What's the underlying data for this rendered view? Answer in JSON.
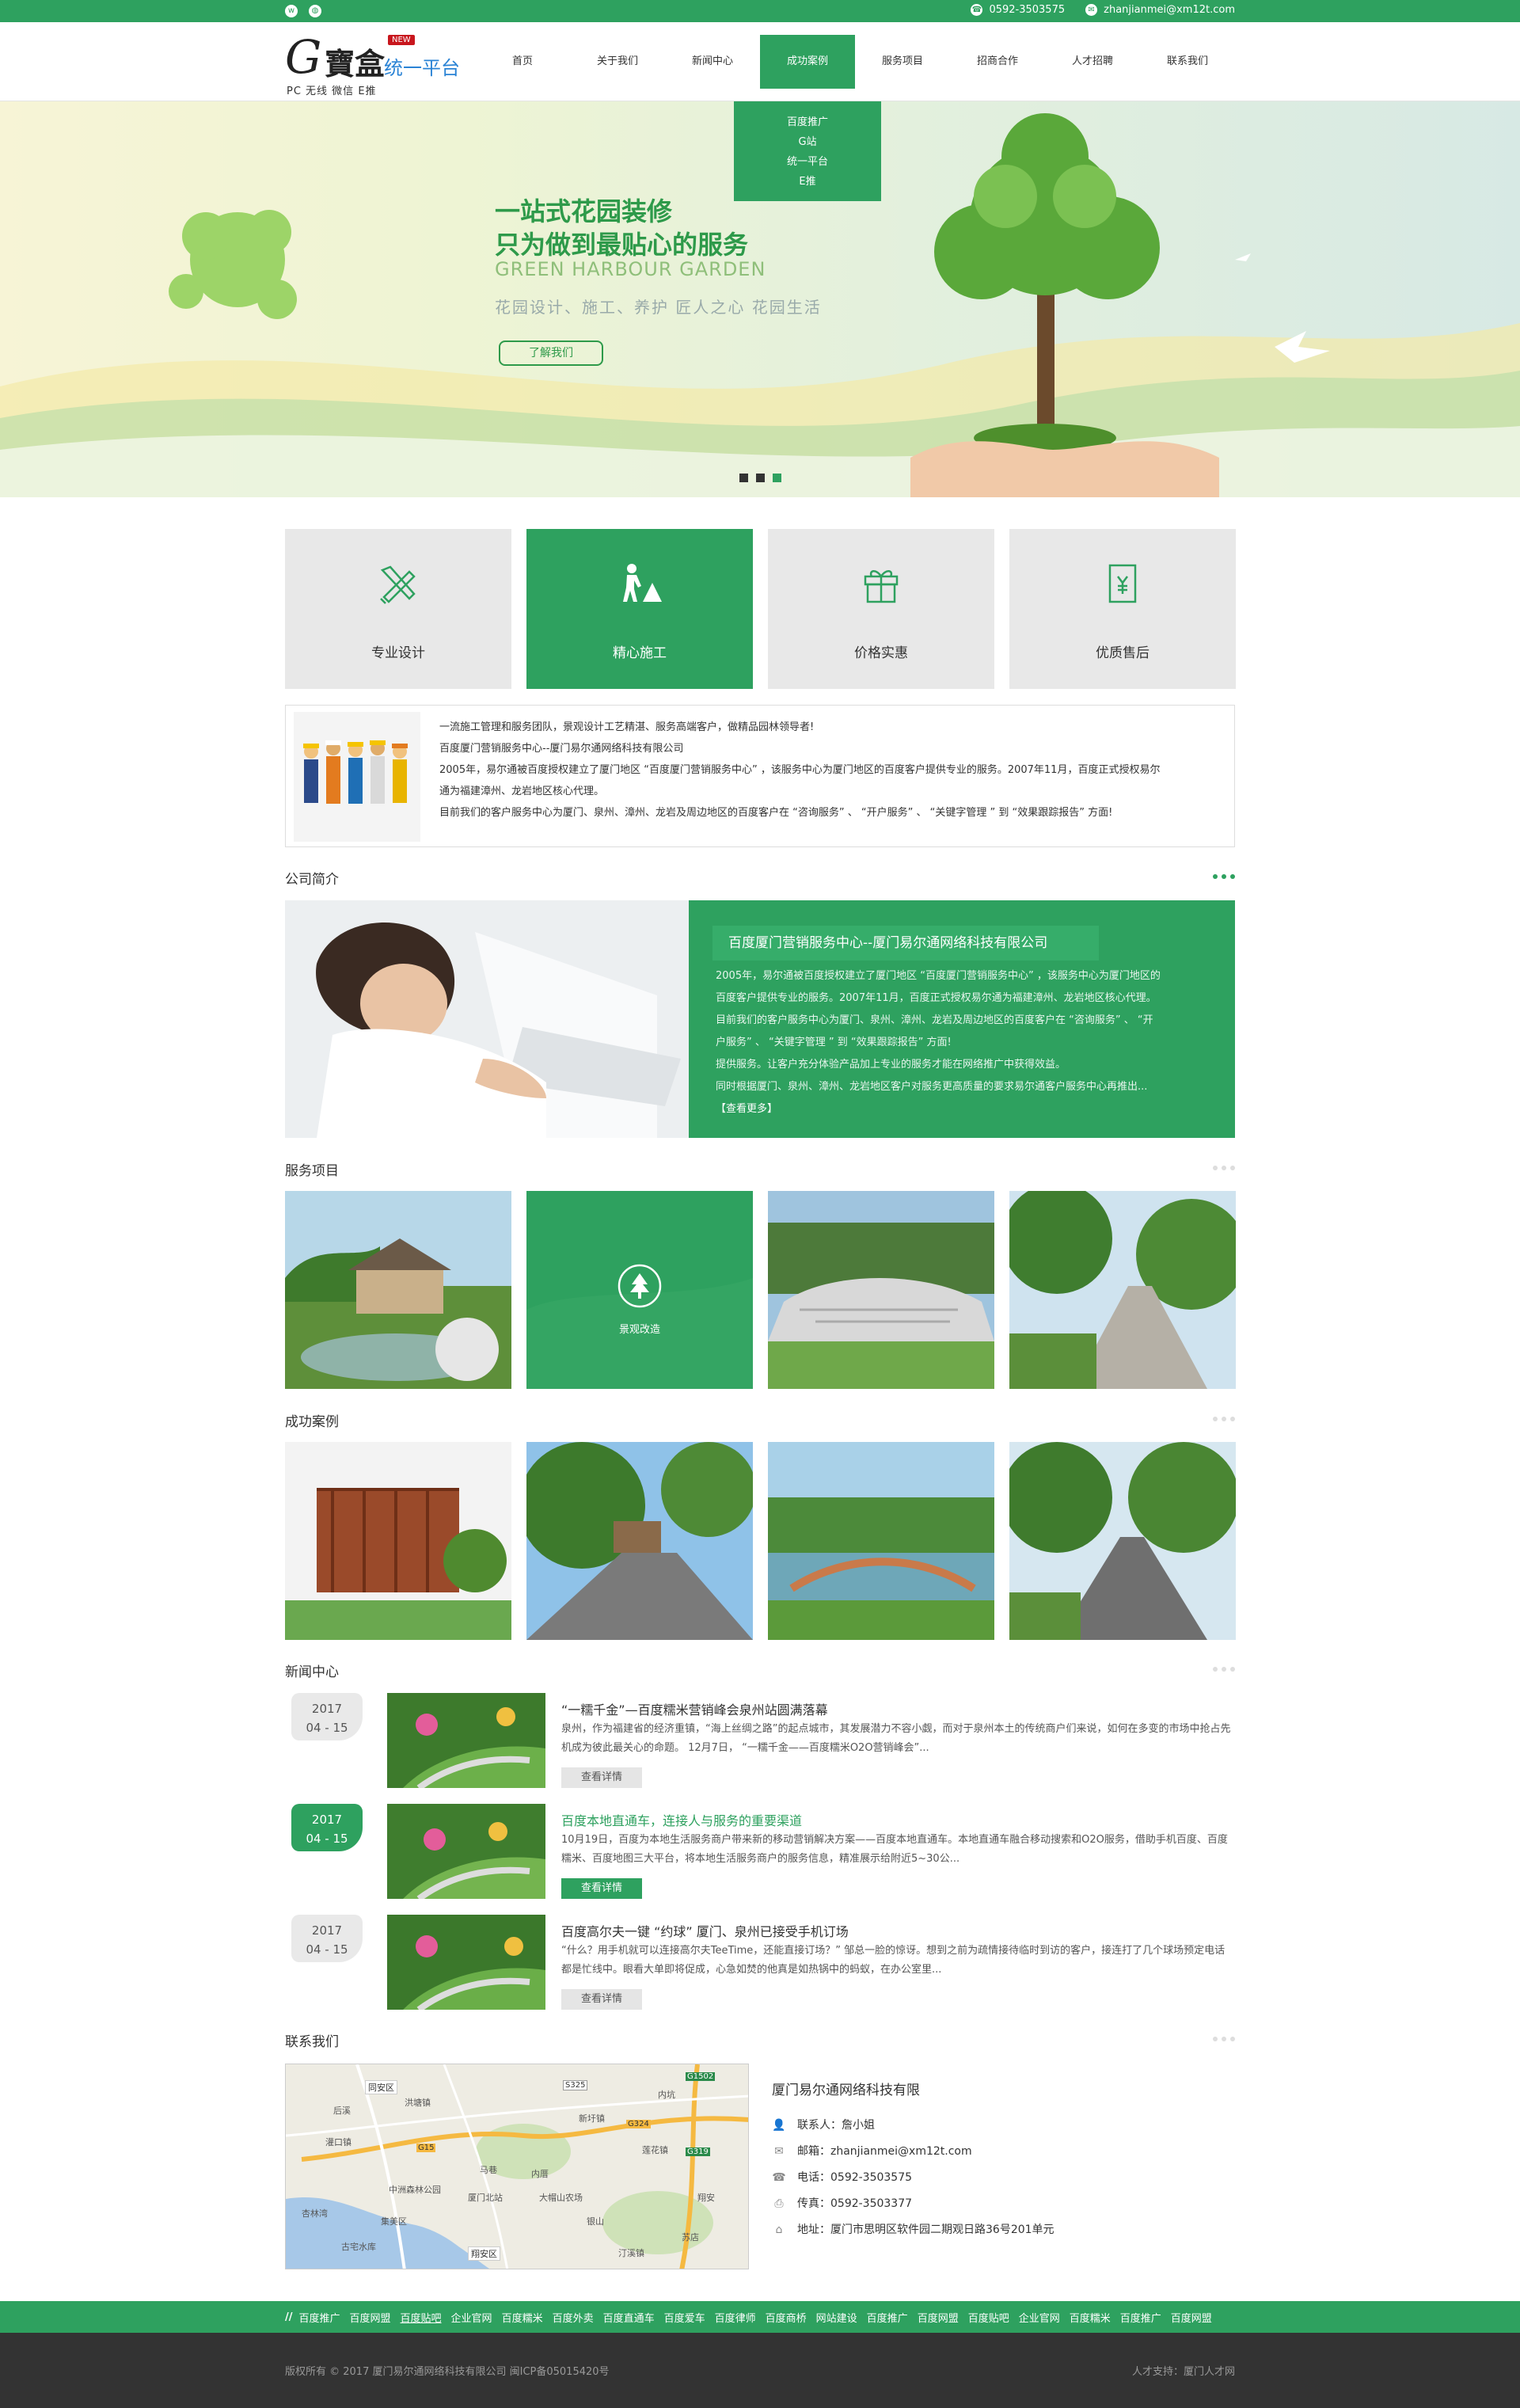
{
  "topbar": {
    "phone": "0592-3503575",
    "email": "zhanjianmei@xm12t.com",
    "social_icons": [
      "weibo-icon",
      "wechat-icon"
    ]
  },
  "logo": {
    "brand": "寶盒",
    "badge": "NEW",
    "platform": "统一平台",
    "sub": "PC 无线  微信  E推"
  },
  "nav": {
    "items": [
      {
        "label": "首页"
      },
      {
        "label": "关于我们"
      },
      {
        "label": "新闻中心"
      },
      {
        "label": "成功案例"
      },
      {
        "label": "服务项目"
      },
      {
        "label": "招商合作"
      },
      {
        "label": "人才招聘"
      },
      {
        "label": "联系我们"
      }
    ],
    "active_index": 3,
    "dropdown": [
      "百度推广",
      "G站",
      "统一平台",
      "E推"
    ]
  },
  "banner": {
    "line1": "一站式花园装修",
    "line2": "只为做到最贴心的服务",
    "english": "GREEN HARBOUR GARDEN",
    "tagline": "花园设计、施工、养护   匠人之心   花园生活",
    "button": "了解我们",
    "active_dot": 2
  },
  "features": [
    {
      "label": "专业设计",
      "icon": "design-tools-icon"
    },
    {
      "label": "精心施工",
      "icon": "construction-worker-icon"
    },
    {
      "label": "价格实惠",
      "icon": "gift-icon"
    },
    {
      "label": "优质售后",
      "icon": "yuan-document-icon"
    }
  ],
  "features_active": 1,
  "intro": {
    "lines": [
      "一流施工管理和服务团队，景观设计工艺精湛、服务高端客户，做精品园林领导者!",
      "百度厦门营销服务中心--厦门易尔通网络科技有限公司",
      "2005年，易尔通被百度授权建立了厦门地区 “百度厦门营销服务中心” ，该服务中心为厦门地区的百度客户提供专业的服务。2007年11月，百度正式授权易尔",
      "通为福建漳州、龙岩地区核心代理。",
      "目前我们的客户服务中心为厦门、泉州、漳州、龙岩及周边地区的百度客户在 “咨询服务” 、 “开户服务” 、 “关键字管理 ” 到 “效果跟踪报告” 方面!"
    ]
  },
  "sections": {
    "about": "公司简介",
    "services": "服务项目",
    "cases": "成功案例",
    "news": "新闻中心",
    "contact": "联系我们"
  },
  "about": {
    "title": "百度厦门营销服务中心--厦门易尔通网络科技有限公司",
    "lines": [
      "2005年，易尔通被百度授权建立了厦门地区 “百度厦门营销服务中心” ，该服务中心为厦门地区的",
      "百度客户提供专业的服务。2007年11月，百度正式授权易尔通为福建漳州、龙岩地区核心代理。",
      "目前我们的客户服务中心为厦门、泉州、漳州、龙岩及周边地区的百度客户在 “咨询服务” 、 “开",
      "户服务” 、 “关键字管理 ” 到 “效果跟踪报告” 方面!",
      "提供服务。让客户充分体验产品加上专业的服务才能在网络推广中获得效益。",
      "同时根据厦门、泉州、漳州、龙岩地区客户对服务更高质量的要求易尔通客户服务中心再推出..."
    ],
    "more": "【查看更多】"
  },
  "services": {
    "highlight_label": "景观改造",
    "highlight_icon": "tree-icon"
  },
  "news": [
    {
      "year": "2017",
      "date": "04 - 15",
      "title": "“一糯千金”—百度糯米营销峰会泉州站圆满落幕",
      "summary": "泉州，作为福建省的经济重镇，“海上丝绸之路”的起点城市，其发展潜力不容小觑，而对于泉州本土的传统商户们来说，如何在多变的市场中抢占先机成为彼此最关心的命题。 12月7日， “一糯千金——百度糯米O2O营销峰会”...",
      "button": "查看详情"
    },
    {
      "year": "2017",
      "date": "04 - 15",
      "title": "百度本地直通车，连接人与服务的重要渠道",
      "summary": "10月19日，百度为本地生活服务商户带来新的移动营销解决方案——百度本地直通车。本地直通车融合移动搜索和O2O服务，借助手机百度、百度糯米、百度地图三大平台，将本地生活服务商户的服务信息，精准展示给附近5~30公...",
      "button": "查看详情"
    },
    {
      "year": "2017",
      "date": "04 - 15",
      "title": "百度高尔夫一键 “约球” 厦门、泉州已接受手机订场",
      "summary": "“什么？用手机就可以连接高尔夫TeeTime，还能直接订场？” 邹总一脸的惊讶。想到之前为疏情接待临时到访的客户，接连打了几个球场预定电话都是忙线中。眼看大单即将促成，心急如焚的他真是如热锅中的蚂蚁，在办公室里...",
      "button": "查看详情"
    }
  ],
  "news_active": 1,
  "contact": {
    "company": "厦门易尔通网络科技有限",
    "rows": [
      {
        "icon": "user-icon",
        "text": "联系人：詹小姐"
      },
      {
        "icon": "mail-icon",
        "text": "邮箱：zhanjianmei@xm12t.com"
      },
      {
        "icon": "phone-icon",
        "text": "电话：0592-3503575"
      },
      {
        "icon": "fax-icon",
        "text": "传真：0592-3503377"
      },
      {
        "icon": "location-icon",
        "text": "地址：厦门市思明区软件园二期观日路36号201单元"
      }
    ],
    "map_labels": [
      "同安区",
      "洪塘镇",
      "中洲森林公园",
      "集美区",
      "厦门北站",
      "灌口镇",
      "马巷",
      "内厝",
      "新圩镇",
      "翔安区",
      "大帽山农场",
      "银山",
      "莲花镇",
      "汀溪镇",
      "古宅水库",
      "苏店",
      "杏林湾",
      "内坑",
      "翔安",
      "后溪"
    ],
    "map_roads": [
      "G15",
      "G324",
      "G1502",
      "G319",
      "S325"
    ]
  },
  "footer_links": [
    "百度推广",
    "百度网盟",
    "百度贴吧",
    "企业官网",
    "百度糯米",
    "百度外卖",
    "百度直通车",
    "百度爱车",
    "百度律师",
    "百度商桥",
    "网站建设",
    "百度推广",
    "百度网盟",
    "百度贴吧",
    "企业官网",
    "百度糯米",
    "百度推广",
    "百度网盟"
  ],
  "footer_link_highlight": 2,
  "footer": {
    "copyright": "版权所有 © 2017 厦门易尔通网络科技有限公司   闽ICP备05015420号",
    "tech": "人才支持：厦门人才网"
  },
  "colors": {
    "brand_green": "#2ea15f",
    "logo_blue": "#2a83d5",
    "badge_red": "#c8161d",
    "footer_dark": "#333333"
  }
}
